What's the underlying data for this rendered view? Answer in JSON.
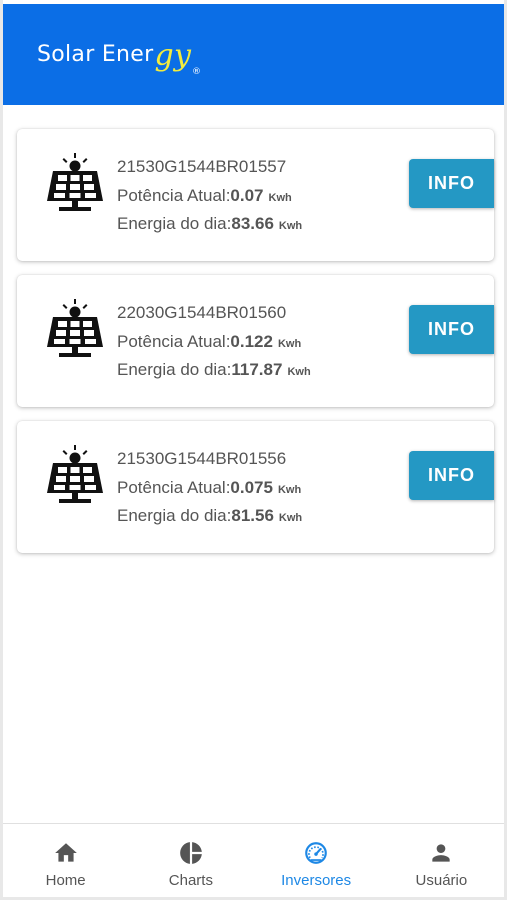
{
  "app": {
    "brand_prefix": "Solar Ener",
    "brand_script": "gy",
    "brand_reg": "®",
    "header_color": "#0b6ee6",
    "accent_text_color": "#f2ec3f"
  },
  "inverters": [
    {
      "icon": "solar-panel-icon",
      "serial": "21530G1544BR01557",
      "power_label": "Potência Atual:",
      "power_value": "0.07",
      "power_unit": "Kwh",
      "energy_label": "Energia do dia:",
      "energy_value": "83.66",
      "energy_unit": "Kwh",
      "button_label": "INFO"
    },
    {
      "icon": "solar-panel-icon",
      "serial": "22030G1544BR01560",
      "power_label": "Potência Atual:",
      "power_value": "0.122",
      "power_unit": "Kwh",
      "energy_label": "Energia do dia:",
      "energy_value": "117.87",
      "energy_unit": "Kwh",
      "button_label": "INFO"
    },
    {
      "icon": "solar-panel-icon",
      "serial": "21530G1544BR01556",
      "power_label": "Potência Atual:",
      "power_value": "0.075",
      "power_unit": "Kwh",
      "energy_label": "Energia do dia:",
      "energy_value": "81.56",
      "energy_unit": "Kwh",
      "button_label": "INFO"
    }
  ],
  "button_color": "#2498c4",
  "bottom_nav": {
    "active_color": "#1e88e5",
    "items": [
      {
        "label": "Home",
        "icon": "home-icon",
        "active": false
      },
      {
        "label": "Charts",
        "icon": "pie-chart-icon",
        "active": false
      },
      {
        "label": "Inversores",
        "icon": "speedometer-icon",
        "active": true
      },
      {
        "label": "Usuário",
        "icon": "user-icon",
        "active": false
      }
    ]
  }
}
